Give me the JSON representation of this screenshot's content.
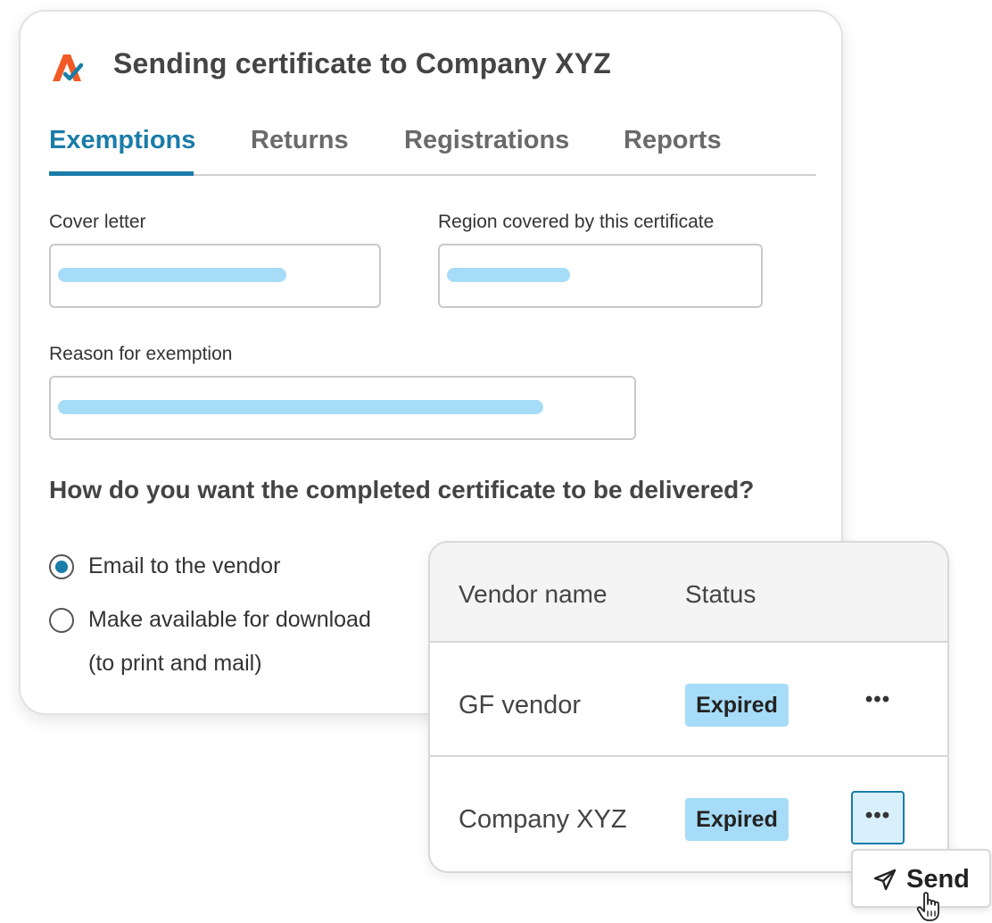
{
  "dialog": {
    "title": "Sending certificate to Company XYZ",
    "tabs": [
      {
        "label": "Exemptions",
        "active": true
      },
      {
        "label": "Returns",
        "active": false
      },
      {
        "label": "Registrations",
        "active": false
      },
      {
        "label": "Reports",
        "active": false
      }
    ],
    "fields": {
      "cover_letter_label": "Cover letter",
      "region_label": "Region covered by this certificate",
      "reason_label": "Reason for exemption"
    },
    "delivery": {
      "question": "How do you want the completed certificate to be delivered?",
      "options": [
        {
          "label": "Email to the vendor",
          "selected": true
        },
        {
          "label": "Make available for download",
          "sublabel": "(to print and mail)",
          "selected": false
        }
      ]
    }
  },
  "vendors": {
    "columns": [
      "Vendor name",
      "Status"
    ],
    "rows": [
      {
        "name": "GF vendor",
        "status": "Expired",
        "more": "•••"
      },
      {
        "name": "Company XYZ",
        "status": "Expired",
        "more": "•••"
      }
    ],
    "send_label": "Send"
  },
  "colors": {
    "accent": "#1a7ca8",
    "badge": "#a6dcf7",
    "logo_orange": "#f15a24",
    "logo_blue": "#1a7ca8"
  }
}
